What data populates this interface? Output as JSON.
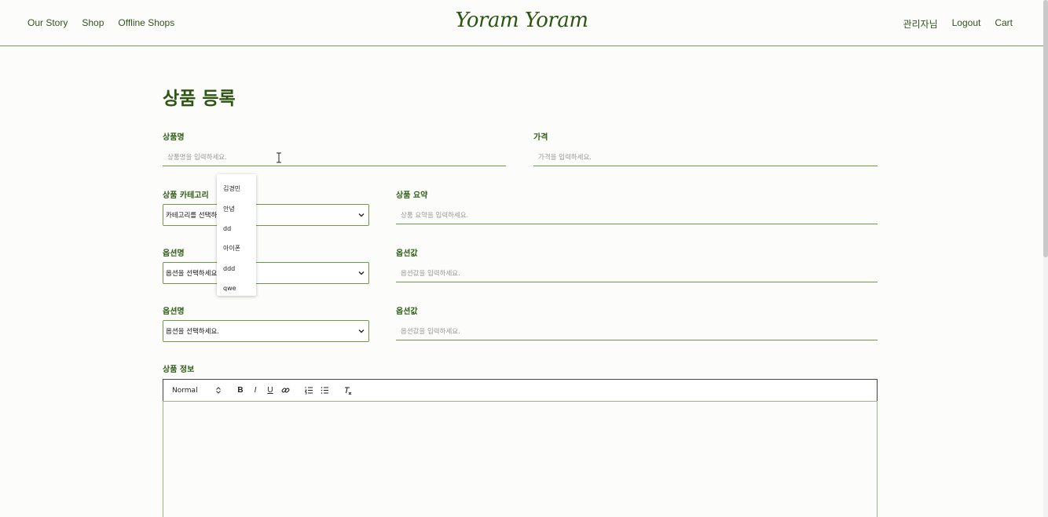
{
  "header": {
    "nav_left": [
      "Our Story",
      "Shop",
      "Offline Shops"
    ],
    "logo": "Yoram Yoram",
    "nav_right": [
      "관리자님",
      "Logout",
      "Cart"
    ]
  },
  "form": {
    "title": "상품 등록",
    "product_name": {
      "label": "상품명",
      "placeholder": "상품명을 입력하세요."
    },
    "price": {
      "label": "가격",
      "placeholder": "가격을 입력하세요."
    },
    "category": {
      "label": "상품 카테고리",
      "selected": "카테고리를 선택하세요."
    },
    "summary": {
      "label": "상품 요약",
      "placeholder": "상품 요약을 입력하세요."
    },
    "option1": {
      "label": "옵션명",
      "selected": "옵션을 선택하세요."
    },
    "option1_value": {
      "label": "옵션값",
      "placeholder": "옵션값을 입력하세요."
    },
    "option2": {
      "label": "옵션명",
      "selected": "옵션을 선택하세요."
    },
    "option2_value": {
      "label": "옵션값",
      "placeholder": "옵션값을 입력하세요."
    },
    "info": {
      "label": "상품 정보"
    }
  },
  "dropdown": {
    "items": [
      "김경민",
      "안녕",
      "dd",
      "아이폰",
      "ddd",
      "qwe"
    ]
  },
  "editor": {
    "font_select": "Normal",
    "buttons": [
      "B",
      "I",
      "U"
    ]
  },
  "colors": {
    "accent": "#2f5d16",
    "border": "#6d9a45"
  }
}
